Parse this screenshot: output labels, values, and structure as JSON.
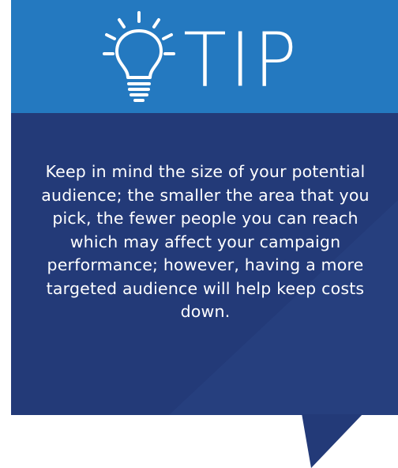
{
  "tip": {
    "title": "TIP",
    "icon": "lightbulb-icon",
    "body_text": "Keep in mind the size of your potential audience; the smaller the area that you pick, the fewer people you can reach which may affect your campaign performance; however, having a more targeted audience will help keep costs down."
  },
  "colors": {
    "header_blue": "#2479c0",
    "body_navy": "#233a78",
    "text": "#ffffff"
  }
}
